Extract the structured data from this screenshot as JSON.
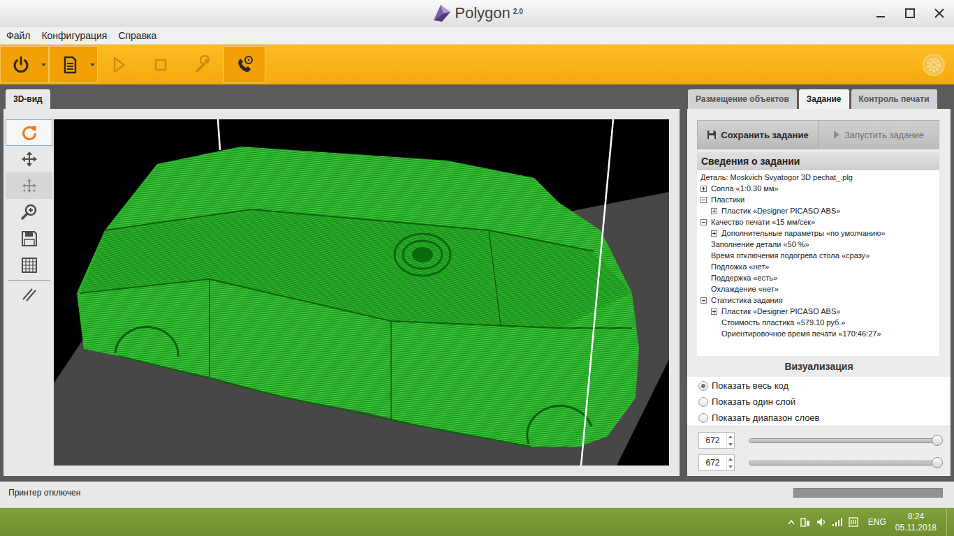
{
  "window": {
    "title": "Polygon",
    "version": "2.0"
  },
  "menu": [
    {
      "label": "Файл"
    },
    {
      "label": "Конфигурация"
    },
    {
      "label": "Справка"
    }
  ],
  "toolbar": {
    "buttons": [
      {
        "disabled": false,
        "kind": "split"
      },
      {
        "disabled": false,
        "kind": "split"
      },
      {
        "disabled": true,
        "kind": "plain"
      },
      {
        "disabled": true,
        "kind": "plain"
      },
      {
        "disabled": true,
        "kind": "plain"
      },
      {
        "disabled": false,
        "kind": "plain"
      }
    ],
    "status_icon": {
      "disabled": true
    }
  },
  "left_tabs": [
    {
      "label": "3D-вид",
      "selected": true
    }
  ],
  "tools": [
    {
      "selected": true,
      "disabled": false
    },
    {
      "selected": false,
      "disabled": false
    },
    {
      "selected": false,
      "disabled": true
    },
    {
      "selected": false,
      "disabled": false
    },
    {
      "selected": false,
      "disabled": false
    },
    {
      "selected": false,
      "disabled": false
    },
    {
      "selected": false,
      "disabled": false
    }
  ],
  "right_tabs": [
    {
      "label": "Размещение объектов",
      "selected": false
    },
    {
      "label": "Задание",
      "selected": true
    },
    {
      "label": "Контроль печати",
      "selected": false
    }
  ],
  "task_buttons": [
    {
      "label": "Сохранить задание",
      "disabled": false
    },
    {
      "label": "Запустить задание",
      "disabled": true
    }
  ],
  "info": {
    "title": "Сведения о задании",
    "rows": [
      {
        "text": "Деталь: Moskvich Svyatogor 3D pechat_.plg",
        "depth": 0,
        "expandable": false,
        "expanded": false
      },
      {
        "text": "Сопла «1:0.30 мм»",
        "depth": 0,
        "expandable": true,
        "expanded": false
      },
      {
        "text": "Пластики",
        "depth": 0,
        "expandable": true,
        "expanded": true
      },
      {
        "text": "Пластик «Designer PICASO ABS»",
        "depth": 1,
        "expandable": true,
        "expanded": false
      },
      {
        "text": "Качество печати «15 мм/сек»",
        "depth": 0,
        "expandable": true,
        "expanded": true
      },
      {
        "text": "Дополнительные параметры «по умолчанию»",
        "depth": 1,
        "expandable": true,
        "expanded": false
      },
      {
        "text": "Заполнение детали «50 %»",
        "depth": 1,
        "expandable": false,
        "expanded": false
      },
      {
        "text": "Время отключения подогрева стола «сразу»",
        "depth": 1,
        "expandable": false,
        "expanded": false
      },
      {
        "text": "Подложка «нет»",
        "depth": 1,
        "expandable": false,
        "expanded": false
      },
      {
        "text": "Поддержка «есть»",
        "depth": 1,
        "expandable": false,
        "expanded": false
      },
      {
        "text": "Охлаждение «нет»",
        "depth": 1,
        "expandable": false,
        "expanded": false
      },
      {
        "text": "Статистика задания",
        "depth": 0,
        "expandable": true,
        "expanded": true
      },
      {
        "text": "Пластик «Designer PICASO ABS»",
        "depth": 1,
        "expandable": true,
        "expanded": false
      },
      {
        "text": "Стоимость пластика «579.10 руб.»",
        "depth": 2,
        "expandable": false,
        "expanded": false
      },
      {
        "text": "Ориентировочное время печати «170:46:27»",
        "depth": 2,
        "expandable": false,
        "expanded": false
      }
    ]
  },
  "visualization": {
    "title": "Визуализация",
    "modes": [
      {
        "label": "Показать весь код",
        "selected": true
      },
      {
        "label": "Показать один слой",
        "selected": false
      },
      {
        "label": "Показать диапазон слоев",
        "selected": false
      }
    ],
    "sliders": [
      {
        "value": "672",
        "level": 1
      },
      {
        "value": "672",
        "level": 1
      }
    ]
  },
  "status_bar": {
    "text": "Принтер отключен",
    "progress": {
      "level": 0
    }
  },
  "taskbar": {
    "language": "ENG",
    "time": "8:24",
    "date": "05.11.2018"
  }
}
